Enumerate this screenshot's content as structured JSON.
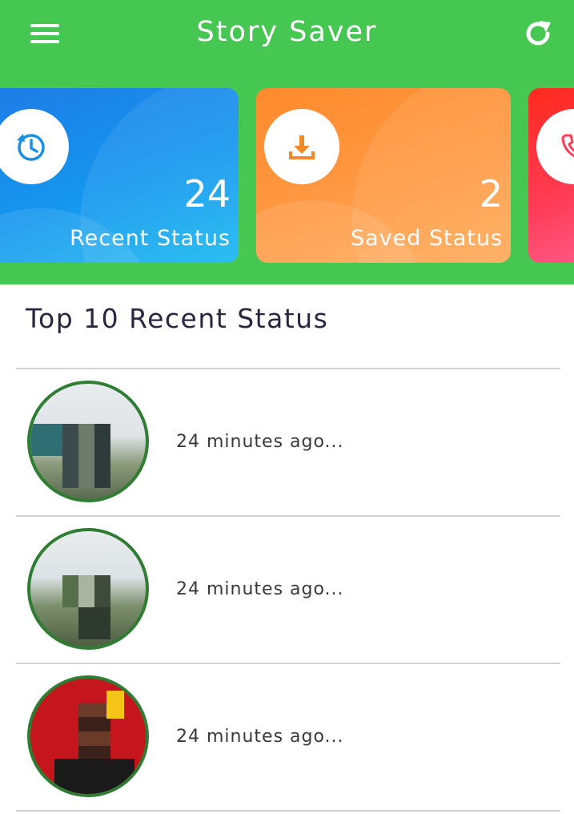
{
  "app": {
    "title": "Story Saver"
  },
  "colors": {
    "header": "#45c752",
    "avatar_border": "#2e7d32"
  },
  "icons": {
    "menu": "hamburger-menu-icon",
    "refresh": "refresh-icon",
    "recent": "clock-history-icon",
    "saved": "download-icon",
    "third": "phone-icon"
  },
  "cards": [
    {
      "count": "24",
      "label": "Recent Status"
    },
    {
      "count": "2",
      "label": "Saved Status"
    }
  ],
  "section": {
    "title": "Top 10 Recent Status"
  },
  "statuses": [
    {
      "time": "24 minutes ago..."
    },
    {
      "time": "24 minutes ago..."
    },
    {
      "time": "24 minutes ago..."
    }
  ]
}
